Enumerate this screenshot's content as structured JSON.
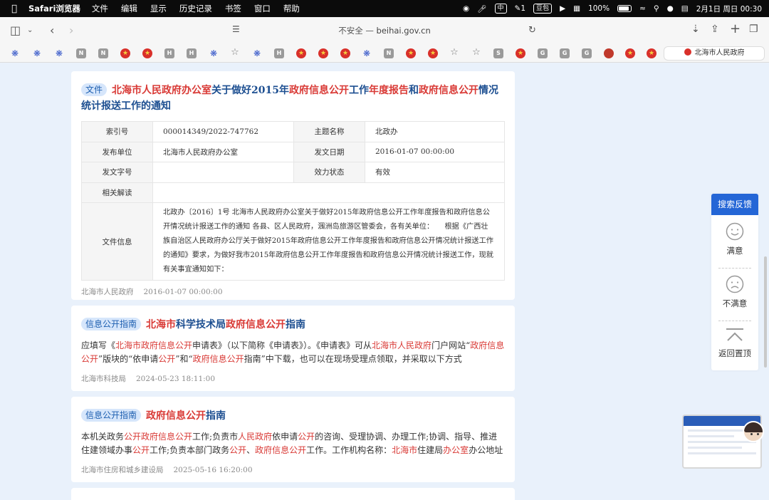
{
  "menubar": {
    "app_name": "Safari浏览器",
    "menus": [
      "文件",
      "编辑",
      "显示",
      "历史记录",
      "书签",
      "窗口",
      "帮助"
    ],
    "badge_1": "中",
    "notif_count": "1",
    "badge_2": "豆包",
    "battery": "100%",
    "datetime": "2月1日 周日  00:30"
  },
  "toolbar": {
    "address_prefix": "不安全 —",
    "address_host": "beihai.gov.cn"
  },
  "favorites": {
    "letters": [
      "N",
      "N",
      "H",
      "H",
      "H",
      "N",
      "S",
      "G",
      "G",
      "G"
    ],
    "active_tab": "北海市人民政府"
  },
  "card1": {
    "tag": "文件",
    "title_parts": [
      "北海市人民政府办公室",
      "关于做好2015年",
      "政府信息公开",
      "工作",
      "年度报告",
      "和",
      "政府信息公开",
      "情况统计报送工作的通知"
    ],
    "rows": [
      {
        "k1": "索引号",
        "v1": "000014349/2022-747762",
        "k2": "主题名称",
        "v2": "北政办"
      },
      {
        "k1": "发布单位",
        "v1": "北海市人民政府办公室",
        "k2": "发文日期",
        "v2": "2016-01-07 00:00:00"
      },
      {
        "k1": "发文字号",
        "v1": "",
        "k2": "效力状态",
        "v2": "有效"
      }
    ],
    "related_label": "相关解读",
    "related_value": "",
    "info_label": "文件信息",
    "info_text": "北政办〔2016〕1号 北海市人民政府办公室关于做好2015年政府信息公开工作年度报告和政府信息公开情况统计报送工作的通知 各县、区人民政府，涠洲岛旅游区管委会，各有关单位：　　根据《广西壮族自治区人民政府办公厅关于做好2015年政府信息公开工作年度报告和政府信息公开情况统计报送工作的通知》要求，为做好我市2015年政府信息公开工作年度报告和政府信息公开情况统计报送工作，现就有关事宜通知如下：",
    "source": "北海市人民政府",
    "date": "2016-01-07 00:00:00"
  },
  "card2": {
    "tag": "信息公开指南",
    "title_parts": [
      "北海市",
      "科学技术局",
      "政府信息公开",
      "指南"
    ],
    "body_parts": [
      "应填写《",
      "北海市政府信息公开",
      "申请表》（以下简称《申请表》）。《申请表》可从",
      "北海市人民政府",
      "门户网站“",
      "政府信息公开",
      "”版块的“依申请",
      "公开",
      "”和“",
      "政府信息公开",
      "指南”中下载，也可以在现场受理点领取，并采取以下方式"
    ],
    "source": "北海市科技局",
    "date": "2024-05-23 18:11:00"
  },
  "card3": {
    "tag": "信息公开指南",
    "title_parts": [
      "政府信息公开",
      "指南"
    ],
    "body_parts": [
      "本机关政务",
      "公开",
      "政府信息公开",
      "工作;负责市",
      "人民政府",
      "依申请",
      "公开",
      "的咨询、受理协调、办理工作;协调、指导、推进住建领域办事",
      "公开",
      "工作;负责本部门政务",
      "公开",
      "、",
      "政府信息公开",
      "工作。工作机构名称：",
      "北海市",
      "住建局",
      "办公室",
      "办公地址"
    ],
    "source": "北海市住房和城乡建设局",
    "date": "2025-05-16 16:20:00"
  },
  "feedback": {
    "header": "搜索反馈",
    "satisfied": "满意",
    "unsatisfied": "不满意",
    "back_to_top": "返回置顶"
  }
}
